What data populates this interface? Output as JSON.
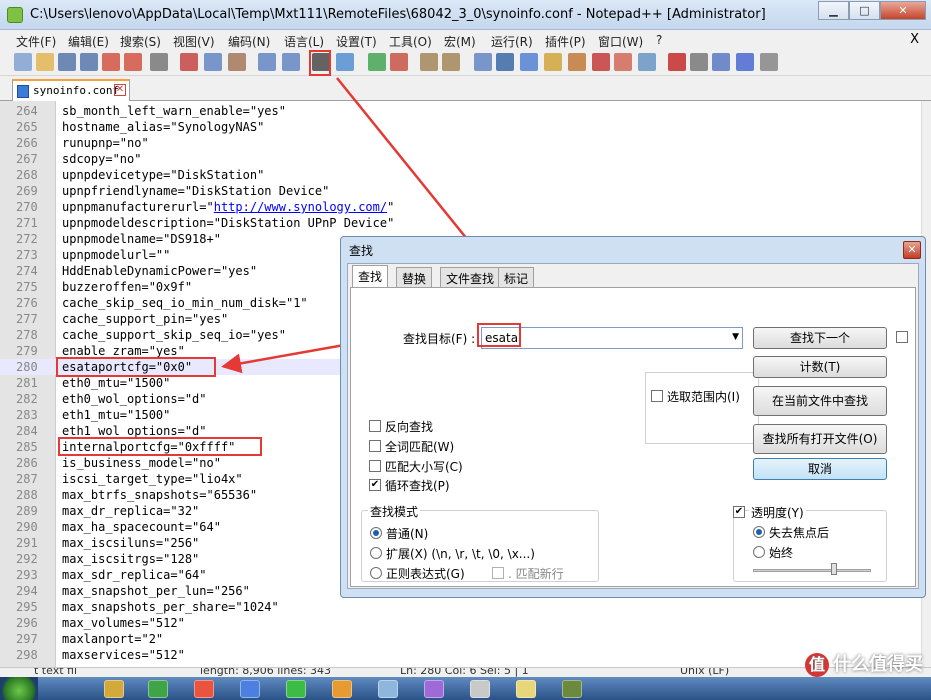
{
  "window": {
    "title": "C:\\Users\\lenovo\\AppData\\Local\\Temp\\Mxt111\\RemoteFiles\\68042_3_0\\synoinfo.conf - Notepad++ [Administrator]",
    "min_label": "▁",
    "max_label": "□",
    "close_label": "✕"
  },
  "menu": {
    "items": [
      "文件(F)",
      "编辑(E)",
      "搜索(S)",
      "视图(V)",
      "编码(N)",
      "语言(L)",
      "设置(T)",
      "工具(O)",
      "宏(M)",
      "运行(R)",
      "插件(P)",
      "窗口(W)",
      "?"
    ],
    "close": "X"
  },
  "toolbar": {
    "icons": [
      "new-file-icon",
      "open-file-icon",
      "save-icon",
      "save-all-icon",
      "close-icon",
      "close-all-icon",
      "print-icon",
      "cut-icon",
      "copy-icon",
      "paste-icon",
      "undo-icon",
      "redo-icon",
      "find-icon",
      "replace-icon",
      "zoom-in-icon",
      "zoom-out-icon",
      "sync-v-icon",
      "sync-h-icon",
      "wrap-icon",
      "all-chars-icon",
      "indent-guide-icon",
      "udl-icon",
      "doc-map-icon",
      "function-list-icon",
      "folder-workspace-icon",
      "monitor-icon",
      "record-icon",
      "stop-icon",
      "play-icon",
      "play-multi-icon",
      "save-macro-icon"
    ]
  },
  "tab": {
    "label": "synoinfo.conf",
    "close": "✕"
  },
  "editor": {
    "lines": [
      {
        "n": "264",
        "t": "sb_month_left_warn_enable=\"yes\""
      },
      {
        "n": "265",
        "t": "hostname_alias=\"SynologyNAS\""
      },
      {
        "n": "266",
        "t": "runupnp=\"no\""
      },
      {
        "n": "267",
        "t": "sdcopy=\"no\""
      },
      {
        "n": "268",
        "t": "upnpdevicetype=\"DiskStation\""
      },
      {
        "n": "269",
        "t": "upnpfriendlyname=\"DiskStation Device\""
      },
      {
        "n": "270",
        "t": "upnpmanufacturerurl=\"",
        "url": "http://www.synology.com/",
        "tail": "\""
      },
      {
        "n": "271",
        "t": "upnpmodeldescription=\"DiskStation UPnP Device\""
      },
      {
        "n": "272",
        "t": "upnpmodelname=\"DS918+\""
      },
      {
        "n": "273",
        "t": "upnpmodelurl=\"\""
      },
      {
        "n": "274",
        "t": "HddEnableDynamicPower=\"yes\""
      },
      {
        "n": "275",
        "t": "buzzeroffen=\"0x9f\""
      },
      {
        "n": "276",
        "t": "cache_skip_seq_io_min_num_disk=\"1\""
      },
      {
        "n": "277",
        "t": "cache_support_pin=\"yes\""
      },
      {
        "n": "278",
        "t": "cache_support_skip_seq_io=\"yes\""
      },
      {
        "n": "279",
        "t": "enable_zram=\"yes\""
      },
      {
        "n": "280",
        "t": "esataportcfg=\"0x0\""
      },
      {
        "n": "281",
        "t": "eth0_mtu=\"1500\""
      },
      {
        "n": "282",
        "t": "eth0_wol_options=\"d\""
      },
      {
        "n": "283",
        "t": "eth1_mtu=\"1500\""
      },
      {
        "n": "284",
        "t": "eth1_wol_options=\"d\""
      },
      {
        "n": "285",
        "t": "internalportcfg=\"0xffff\""
      },
      {
        "n": "286",
        "t": "is_business_model=\"no\""
      },
      {
        "n": "287",
        "t": "iscsi_target_type=\"lio4x\""
      },
      {
        "n": "288",
        "t": "max_btrfs_snapshots=\"65536\""
      },
      {
        "n": "289",
        "t": "max_dr_replica=\"32\""
      },
      {
        "n": "290",
        "t": "max_ha_spacecount=\"64\""
      },
      {
        "n": "291",
        "t": "max_iscsiluns=\"256\""
      },
      {
        "n": "292",
        "t": "max_iscsitrgs=\"128\""
      },
      {
        "n": "293",
        "t": "max_sdr_replica=\"64\""
      },
      {
        "n": "294",
        "t": "max_snapshot_per_lun=\"256\""
      },
      {
        "n": "295",
        "t": "max_snapshots_per_share=\"1024\""
      },
      {
        "n": "296",
        "t": "max_volumes=\"512\""
      },
      {
        "n": "297",
        "t": "maxlanport=\"2\""
      },
      {
        "n": "298",
        "t": "maxservices=\"512\""
      }
    ]
  },
  "status": {
    "left": "t text fil",
    "middle": "length: 8,906   lines: 343",
    "right": "Ln: 280   Col: 6   Sel: 5 | 1",
    "far": "Unix (LF)"
  },
  "dialog": {
    "title": "查找",
    "close": "✕",
    "tabs": [
      "查找",
      "替换",
      "文件查找",
      "标记"
    ],
    "find_label": "查找目标(F) :",
    "find_value": "esata",
    "buttons": {
      "find_next": "查找下一个",
      "count": "计数(T)",
      "find_in_current": "在当前文件中查找",
      "find_all_open": "查找所有打开文件(O)",
      "cancel": "取消"
    },
    "in_selection": "选取范围内(I)",
    "options": {
      "backward": "反向查找",
      "whole_word": "全词匹配(W)",
      "match_case": "匹配大小写(C)",
      "wrap_around": "循环查找(P)"
    },
    "search_mode": {
      "title": "查找模式",
      "normal": "普通(N)",
      "extended": "扩展(X) (\\n, \\r, \\t, \\0, \\x...)",
      "regex": "正则表达式(G)",
      "dot_newline": ". 匹配新行"
    },
    "transparency": {
      "title": "透明度(Y)",
      "on_lose_focus": "失去焦点后",
      "always": "始终",
      "level": 0.7
    }
  },
  "watermark": {
    "logo": "值",
    "text": "什么值得买"
  },
  "colors": {
    "accent_red": "#e53935",
    "selection": "#e8e8ff",
    "tab_accent": "#f4a23a"
  }
}
